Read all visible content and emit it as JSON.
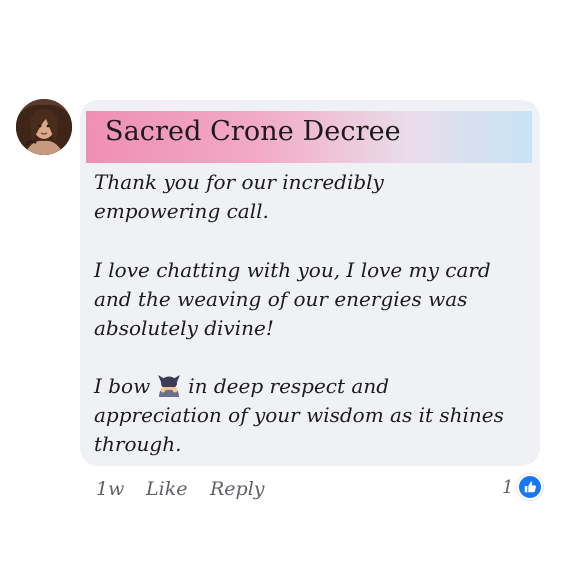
{
  "comment": {
    "author_name": "Sacred Crone Decree",
    "paragraphs": [
      [
        "Thank you for our incredibly",
        "empowering call."
      ],
      [
        "I love chatting with you, I love my card",
        "and the weaving of our energies was",
        "absolutely divine!"
      ]
    ],
    "bow_paragraph": {
      "before_icon": "I bow",
      "after_icon": "in deep respect and",
      "continuation": [
        "appreciation of your wisdom as it shines",
        "through."
      ]
    },
    "inline_icon": "person-bowing-icon"
  },
  "actions": {
    "time": "1w",
    "like_label": "Like",
    "reply_label": "Reply"
  },
  "reactions": {
    "count": "1",
    "icon": "thumbs-up-icon",
    "color": "#1877f2"
  },
  "colors": {
    "bubble": "#f0f1f4",
    "title_gradient": [
      "#ef8fb3",
      "#f2a9c5",
      "#eadcea",
      "#c7e3f6"
    ]
  }
}
